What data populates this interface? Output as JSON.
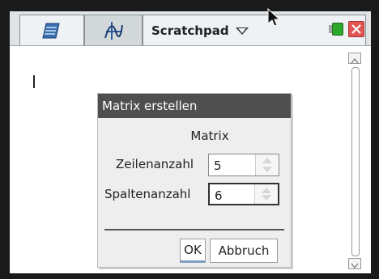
{
  "header": {
    "tabs": [
      {
        "icon": "calculator-icon"
      },
      {
        "icon": "graph-icon"
      }
    ],
    "document_title": "Scratchpad",
    "status_colors": {
      "battery": "#2aa82a",
      "close": "#e25555"
    }
  },
  "dialog": {
    "title": "Matrix erstellen",
    "subtitle": "Matrix",
    "rows_label": "Zeilenanzahl",
    "rows_value": "5",
    "cols_label": "Spaltenanzahl",
    "cols_value": "6",
    "ok_label": "OK",
    "cancel_label": "Abbruch"
  }
}
